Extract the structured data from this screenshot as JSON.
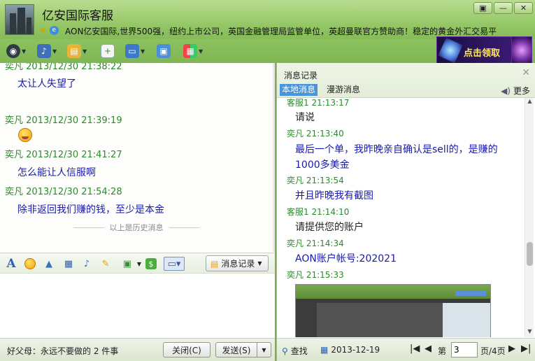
{
  "window": {
    "title": "亿安国际客服",
    "signature": "AON亿安国际,世界500强，纽约上市公司，英国金融管理局监管单位，英超曼联官方赞助商！稳定的黄金外汇交易平",
    "controls": [
      "▣",
      "—",
      "✕"
    ]
  },
  "promo": {
    "label": "点击领取"
  },
  "chat": {
    "messages": [
      {
        "sender": "奕凡",
        "time": "2013/12/30 21:38:22",
        "text": "太让人失望了"
      },
      {
        "sender": "奕凡",
        "time": "2013/12/30 21:39:19",
        "text": ""
      },
      {
        "sender": "奕凡",
        "time": "2013/12/30 21:41:27",
        "text": "怎么能让人信服啊"
      },
      {
        "sender": "奕凡",
        "time": "2013/12/30 21:54:28",
        "text": "除非返回我们赚的钱，至少是本金"
      }
    ],
    "history_divider": "以上是历史消息"
  },
  "edit_toolbar": {
    "message_log_button": "消息记录"
  },
  "bottom": {
    "tip": "好父母：永远不要做的 2 件事",
    "close_button": "关闭(C)",
    "send_button": "发送(S)"
  },
  "log_panel": {
    "title": "消息记录",
    "tabs": [
      "本地消息",
      "漫游消息"
    ],
    "more": "更多",
    "entries": [
      {
        "head": "客服1 21:13:17",
        "body": "请说",
        "style": "dark"
      },
      {
        "head": "奕凡 21:13:40",
        "body": "最后一个单，我昨晚亲自确认是sell的，是赚的1000多美金",
        "style": "blue"
      },
      {
        "head": "奕凡 21:13:54",
        "body": "并且昨晚我有截图",
        "style": "blue"
      },
      {
        "head": "客服1 21:14:10",
        "body": "请提供您的账户",
        "style": "dark"
      },
      {
        "head": "奕凡 21:14:34",
        "body": "AON账户帐号:202021",
        "style": "blue"
      },
      {
        "head": "奕凡 21:15:33",
        "body": "",
        "style": "blue"
      }
    ],
    "footer": {
      "search": "查找",
      "date": "2013-12-19",
      "page_prefix": "第",
      "page_value": "3",
      "page_suffix": "页/4页"
    }
  }
}
